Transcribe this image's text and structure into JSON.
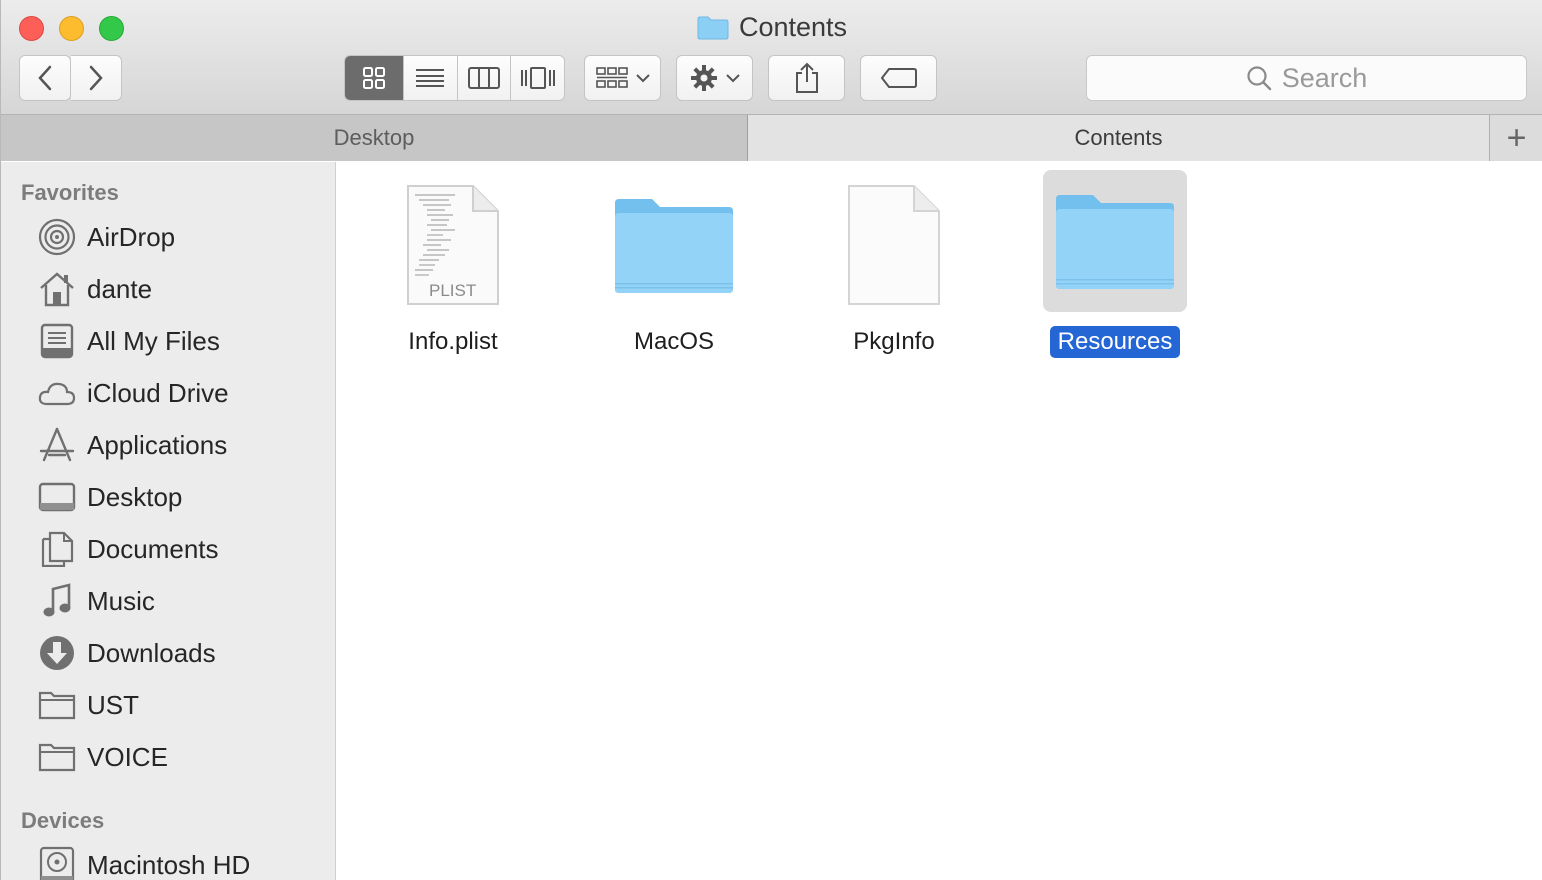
{
  "window": {
    "title": "Contents",
    "title_icon": "folder-icon"
  },
  "toolbar": {
    "back_icon": "chevron-left-icon",
    "forward_icon": "chevron-right-icon",
    "view_modes": [
      "icon-view",
      "list-view",
      "column-view",
      "cover-flow-view"
    ],
    "active_view": "icon-view",
    "arrange_icon": "arrange-grid-icon",
    "action_icon": "gear-icon",
    "share_icon": "share-icon",
    "tag_icon": "tag-icon",
    "search_placeholder": "Search"
  },
  "tabs": [
    {
      "label": "Desktop",
      "active": false
    },
    {
      "label": "Contents",
      "active": true
    }
  ],
  "new_tab_label": "+",
  "sidebar": {
    "favorites_heading": "Favorites",
    "favorites": [
      {
        "label": "AirDrop",
        "icon": "airdrop-icon"
      },
      {
        "label": "dante",
        "icon": "home-icon"
      },
      {
        "label": "All My Files",
        "icon": "all-files-icon"
      },
      {
        "label": "iCloud Drive",
        "icon": "cloud-icon"
      },
      {
        "label": "Applications",
        "icon": "applications-icon"
      },
      {
        "label": "Desktop",
        "icon": "desktop-icon"
      },
      {
        "label": "Documents",
        "icon": "documents-icon"
      },
      {
        "label": "Music",
        "icon": "music-icon"
      },
      {
        "label": "Downloads",
        "icon": "downloads-icon"
      },
      {
        "label": "UST",
        "icon": "folder-icon"
      },
      {
        "label": "VOICE",
        "icon": "folder-icon"
      }
    ],
    "devices_heading": "Devices",
    "devices": [
      {
        "label": "Macintosh HD",
        "icon": "hard-drive-icon"
      }
    ]
  },
  "files": [
    {
      "name": "Info.plist",
      "kind": "plist-file",
      "badge": "PLIST",
      "selected": false
    },
    {
      "name": "MacOS",
      "kind": "folder",
      "selected": false
    },
    {
      "name": "PkgInfo",
      "kind": "document",
      "selected": false
    },
    {
      "name": "Resources",
      "kind": "folder",
      "selected": true
    }
  ],
  "colors": {
    "selection": "#2466d4",
    "folder": "#7cc7f2",
    "close": "#fc5f57",
    "minimize": "#fdbc2e",
    "zoom": "#34c84a"
  }
}
